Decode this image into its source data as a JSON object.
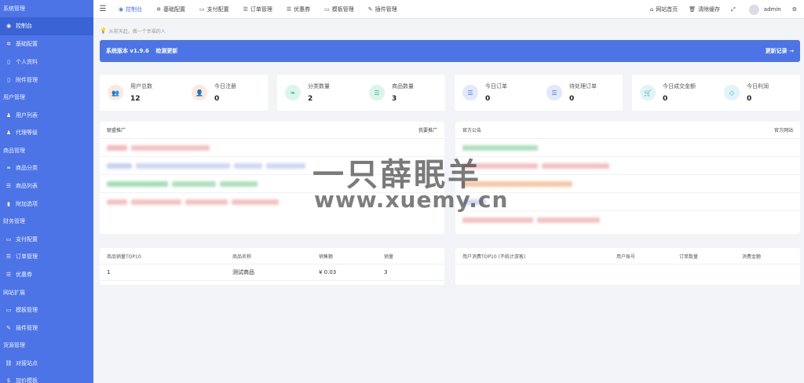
{
  "sidebar": {
    "groups": [
      {
        "title": "系统管理",
        "items": [
          {
            "label": "控制台",
            "icon": "dashboard-icon",
            "active": true
          },
          {
            "label": "基础配置",
            "icon": "gear-icon"
          },
          {
            "label": "个人资料",
            "icon": "file-icon"
          },
          {
            "label": "附件管理",
            "icon": "file-icon"
          }
        ]
      },
      {
        "title": "用户管理",
        "items": [
          {
            "label": "用户列表",
            "icon": "user-icon"
          },
          {
            "label": "代理等级",
            "icon": "user-icon"
          }
        ]
      },
      {
        "title": "商品管理",
        "items": [
          {
            "label": "商品分类",
            "icon": "leaf-icon"
          },
          {
            "label": "商品列表",
            "icon": "list-icon"
          },
          {
            "label": "附加选项",
            "icon": "bookmark-icon"
          }
        ]
      },
      {
        "title": "财务管理",
        "items": [
          {
            "label": "支付配置",
            "icon": "card-icon"
          },
          {
            "label": "订单管理",
            "icon": "list-icon"
          },
          {
            "label": "优惠券",
            "icon": "list-icon"
          }
        ]
      },
      {
        "title": "网站扩展",
        "items": [
          {
            "label": "模板管理",
            "icon": "monitor-icon"
          },
          {
            "label": "插件管理",
            "icon": "plug-icon"
          }
        ]
      },
      {
        "title": "货源管理",
        "items": [
          {
            "label": "对接站点",
            "icon": "link-icon"
          },
          {
            "label": "加价模板",
            "icon": "dollar-icon"
          }
        ]
      }
    ]
  },
  "topbar": {
    "tabs": [
      {
        "label": "控制台",
        "icon": "dashboard-icon",
        "glyph": "◉",
        "active": true
      },
      {
        "label": "基础配置",
        "icon": "gear-icon",
        "glyph": "✲"
      },
      {
        "label": "支付配置",
        "icon": "card-icon",
        "glyph": "▭"
      },
      {
        "label": "订单管理",
        "icon": "list-icon",
        "glyph": "☰"
      },
      {
        "label": "优惠券",
        "icon": "list-icon",
        "glyph": "☰"
      },
      {
        "label": "模板管理",
        "icon": "monitor-icon",
        "glyph": "▭"
      },
      {
        "label": "插件管理",
        "icon": "plug-icon",
        "glyph": "✎"
      }
    ],
    "site_home": "网站首页",
    "clear_cache": "清除缓存",
    "username": "admin"
  },
  "quote": "从前天起，做一个幸福的人",
  "version_bar": {
    "version": "系统版本 v1.9.6",
    "check": "检测更新",
    "changelog": "更新记录 →"
  },
  "stats": [
    [
      {
        "label": "用户总数",
        "value": "12",
        "icon": "users-icon",
        "glyph": "👥",
        "bg": "#fde8dc",
        "fg": "#f07b4a"
      },
      {
        "label": "今日注册",
        "value": "0",
        "icon": "user-icon",
        "glyph": "👤",
        "bg": "#fde8dc",
        "fg": "#f07b4a"
      }
    ],
    [
      {
        "label": "分类数量",
        "value": "2",
        "icon": "leaf-icon",
        "glyph": "❧",
        "bg": "#dcf5ea",
        "fg": "#2dbb7f"
      },
      {
        "label": "商品数量",
        "value": "3",
        "icon": "list-icon",
        "glyph": "☰",
        "bg": "#dcf5ea",
        "fg": "#2dbb7f"
      }
    ],
    [
      {
        "label": "今日订单",
        "value": "0",
        "icon": "list-icon",
        "glyph": "☰",
        "bg": "#e1e9fb",
        "fg": "#4c74e6"
      },
      {
        "label": "待处理订单",
        "value": "0",
        "icon": "list-icon",
        "glyph": "☰",
        "bg": "#e1e9fb",
        "fg": "#4c74e6"
      }
    ],
    [
      {
        "label": "今日成交金额",
        "value": "0",
        "icon": "cart-icon",
        "glyph": "🛒",
        "bg": "#dff5f6",
        "fg": "#26aab8"
      },
      {
        "label": "今日利润",
        "value": "0",
        "icon": "diamond-icon",
        "glyph": "◇",
        "bg": "#dff5f6",
        "fg": "#26aab8"
      }
    ]
  ],
  "promo_panel": {
    "title": "联盟推广",
    "action": "我要推广"
  },
  "notice_panel": {
    "title": "官方公告",
    "action": "官方网站"
  },
  "sales_table": {
    "headers": [
      "商品销量TOP10",
      "商品名称",
      "销售额",
      "销量"
    ],
    "rows": [
      [
        "1",
        "测试商品",
        "¥ 0.03",
        "3"
      ]
    ]
  },
  "user_table": {
    "headers": [
      "用户消费TOP10 (不统计游客)",
      "用户账号",
      "订单数量",
      "消费金额"
    ]
  },
  "watermark": {
    "main": "一只薛眠羊",
    "sub": "www.xuemy.cn"
  },
  "colors": {
    "accent": "#4c74e6",
    "sidebar": "#4c74e6"
  }
}
